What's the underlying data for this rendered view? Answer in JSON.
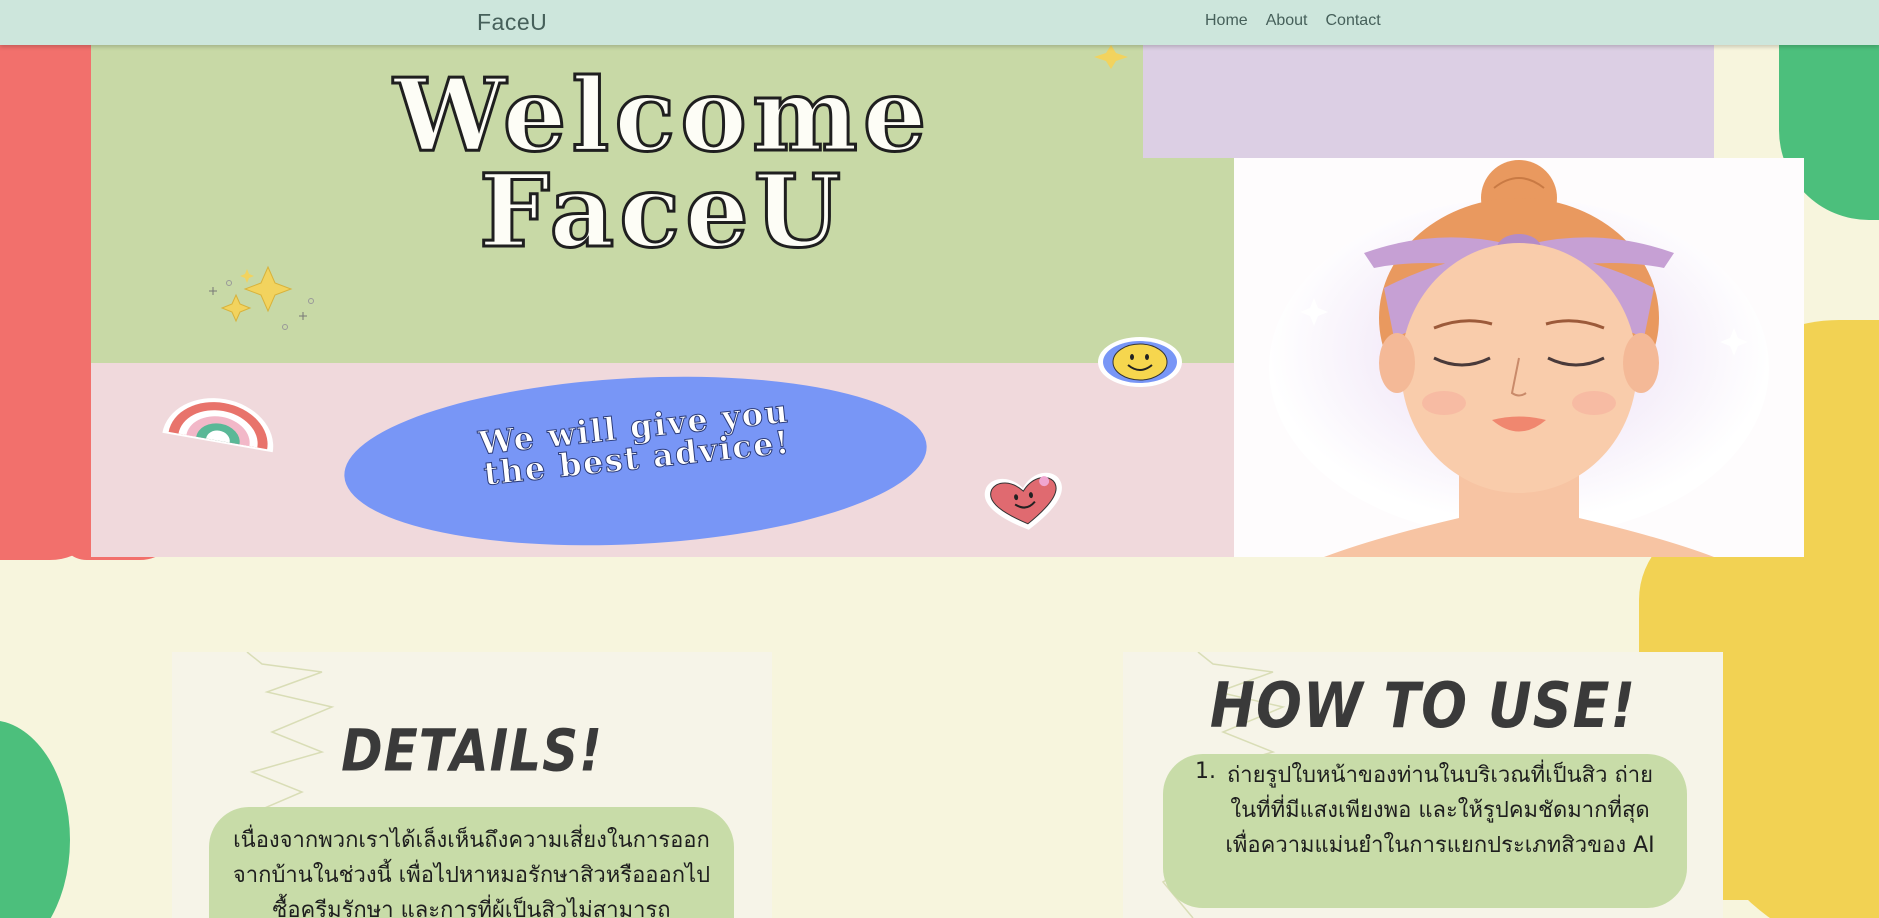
{
  "nav": {
    "brand": "FaceU",
    "links": [
      "Home",
      "About",
      "Contact"
    ]
  },
  "hero": {
    "title_line1": "Welcome",
    "title_line2": "FaceU",
    "tagline_line1": "We will give you",
    "tagline_line2": "the best advice!"
  },
  "details": {
    "title": "DETAILS!",
    "text": "เนื่องจากพวกเราได้เล็งเห็นถึงความเสี่ยงในการออกจากบ้านในช่วงนี้ เพื่อไปหาหมอรักษาสิวหรือออกไปซื้อครีมรักษา และการที่ผู้เป็นสิวไม่สามารถ"
  },
  "how_to_use": {
    "title": "HOW TO USE!",
    "step_number": "1.",
    "step_text": "ถ่ายรูปใบหน้าของท่านในบริเวณที่เป็นสิว ถ่ายในที่ที่มีแสงเพียงพอ และให้รูปคมชัดมากที่สุด เพื่อความแม่นยำในการแยกประเภทสิวของ AI"
  },
  "colors": {
    "nav_bg": "#cde6dc",
    "hero_green": "#c8d9a6",
    "hero_pink": "#f0d9dc",
    "hero_lavender": "#dccfe4",
    "ellipse_blue": "#7896f6",
    "bubble_green": "#c8dca8",
    "page_bg": "#f7f5dd"
  },
  "icons": [
    "sparkle-icon",
    "smiley-icon",
    "rainbow-icon",
    "heart-smiley-icon",
    "woman-face-illustration"
  ]
}
